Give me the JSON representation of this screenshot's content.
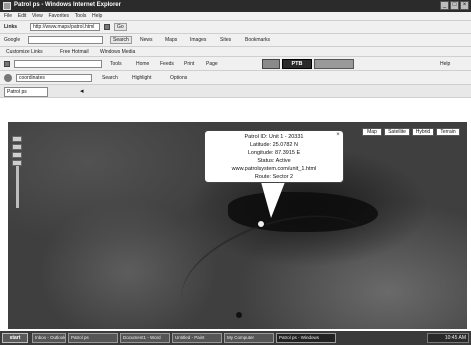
{
  "window": {
    "title": "Patrol ps - Windows Internet Explorer"
  },
  "menu": [
    "File",
    "Edit",
    "View",
    "Favorites",
    "Tools",
    "Help"
  ],
  "address": {
    "label": "Links",
    "value": "http://www.maps/patrol.html",
    "go_label": "Go"
  },
  "google_bar": {
    "label": "Google",
    "search_label": "Search",
    "links": [
      "News",
      "Maps",
      "Images",
      "Sites",
      "Bookmarks"
    ]
  },
  "links_bar": {
    "items": [
      "Customize Links",
      "Free Hotmail",
      "Windows Media"
    ]
  },
  "toolbar4": {
    "items": [
      "Tools",
      "Home",
      "Feeds",
      "Print",
      "Page",
      "Help"
    ],
    "highlight": "PTB"
  },
  "toolbar5": {
    "value": "coordinates",
    "items": [
      "Search",
      "Highlight",
      "Options"
    ]
  },
  "tab": {
    "label": "Patrol ps"
  },
  "map": {
    "types": [
      "Map",
      "Satellite",
      "Hybrid",
      "Terrain"
    ],
    "popup": {
      "lines": [
        "Patrol ID: Unit 1 - 20331",
        "Latitude: 25.0782 N",
        "Longitude: 87.3915 E",
        "Status: Active",
        "www.patrolsystem.com/unit_1.html",
        "Route: Sector 2"
      ]
    }
  },
  "taskbar": {
    "start": "start",
    "tasks": [
      "Inbox - Outlook",
      "Patrol ps",
      "Document1 - Word",
      "Untitled - Paint",
      "My Computer",
      "Patrol ps - Windows"
    ],
    "clock": "10:45 AM"
  }
}
